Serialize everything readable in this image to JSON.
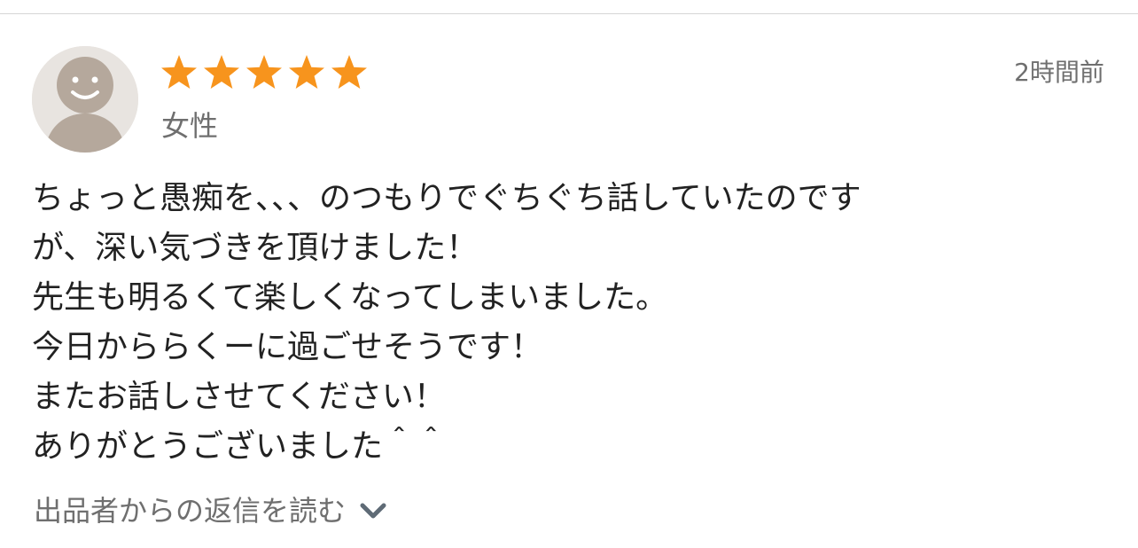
{
  "review": {
    "rating": 5,
    "rating_max": 5,
    "star_color": "#f7941d",
    "avatar_icon": "default-user-avatar",
    "reviewer_gender": "女性",
    "timestamp": "2時間前",
    "comment_lines": [
      "ちょっと愚痴を、、、のつもりでぐちぐち話していたのです",
      "が、深い気づきを頂けました！",
      "先生も明るくて楽しくなってしまいました。",
      "今日かららくーに過ごせそうです！",
      "またお話しさせてください！",
      "ありがとうございました＾＾"
    ],
    "reply_toggle_label": "出品者からの返信を読む",
    "reply_toggle_icon": "chevron-down-icon"
  }
}
